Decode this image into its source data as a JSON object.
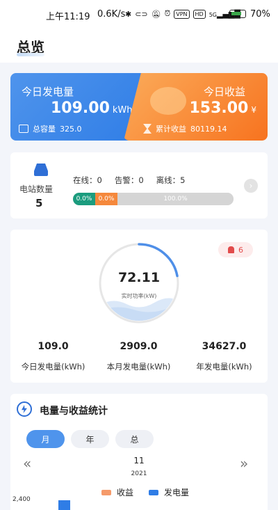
{
  "status_bar": {
    "time": "上午11:19",
    "net_speed": "0.6K/s",
    "vpn": "VPN",
    "hd": "HD",
    "signal": "5G",
    "battery": "70%"
  },
  "header": {
    "title": "总览"
  },
  "today_generation": {
    "label": "今日发电量",
    "value": "109.00",
    "unit": "kWh",
    "capacity_label": "总容量",
    "capacity_value": "325.0"
  },
  "today_revenue": {
    "label": "今日收益",
    "value": "153.00",
    "unit": "¥",
    "cumulative_label": "累计收益",
    "cumulative_value": "80119.14"
  },
  "stations": {
    "label": "电站数量",
    "count": "5",
    "online": "在线：0",
    "alarm": "告警：0",
    "offline": "离线：5",
    "online_pct": "0.0%",
    "alarm_pct": "0.0%",
    "offline_pct": "100.0%"
  },
  "power": {
    "alarm_count": "6",
    "gauge_value": "72.11",
    "gauge_label": "实时功率(kW)",
    "gauge_fraction": 0.22,
    "stats": [
      {
        "value": "109.0",
        "label": "今日发电量(kWh)"
      },
      {
        "value": "2909.0",
        "label": "本月发电量(kWh)"
      },
      {
        "value": "34627.0",
        "label": "年发电量(kWh)"
      }
    ]
  },
  "chart_section": {
    "title": "电量与收益统计",
    "tabs": [
      "月",
      "年",
      "总"
    ],
    "active_tab": "月",
    "prev_icon": "double-chevron-left",
    "next_icon": "double-chevron-right",
    "month": "11",
    "year": "2021"
  },
  "chart_data": {
    "type": "bar",
    "legend": [
      {
        "name": "收益",
        "color": "#f59a6a"
      },
      {
        "name": "发电量",
        "color": "#2f7de6"
      }
    ],
    "yticks": [
      "2,400"
    ],
    "series": [
      {
        "name": "发电量",
        "values": []
      },
      {
        "name": "收益",
        "values": []
      }
    ]
  }
}
